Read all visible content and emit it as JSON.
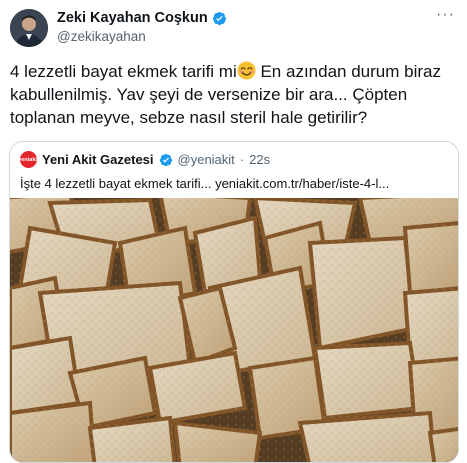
{
  "author": {
    "name": "Zeki Kayahan Coşkun",
    "handle": "@zekikayahan",
    "verified": true
  },
  "tweet": {
    "text_part1": "4 lezzetli bayat ekmek tarifi mi",
    "text_part2": " En azından durum biraz kabullenilmiş. Yav şeyi de versenize bir ara... Çöpten toplanan meyve, sebze nasıl steril hale getirilir?",
    "emoji": "smiling-face-emoji"
  },
  "quoted": {
    "name": "Yeni Akit Gazetesi",
    "handle": "@yeniakit",
    "separator": "·",
    "time": "22s",
    "text": "İşte 4 lezzetli bayat ekmek tarifi... yeniakit.com.tr/haber/iste-4-l...",
    "logo_text": "yeniakit",
    "image": "pile-of-stale-bread-slices"
  },
  "colors": {
    "verified_blue": "#1d9bf0",
    "logo_red": "#e3262b",
    "secondary_text": "#536471"
  }
}
